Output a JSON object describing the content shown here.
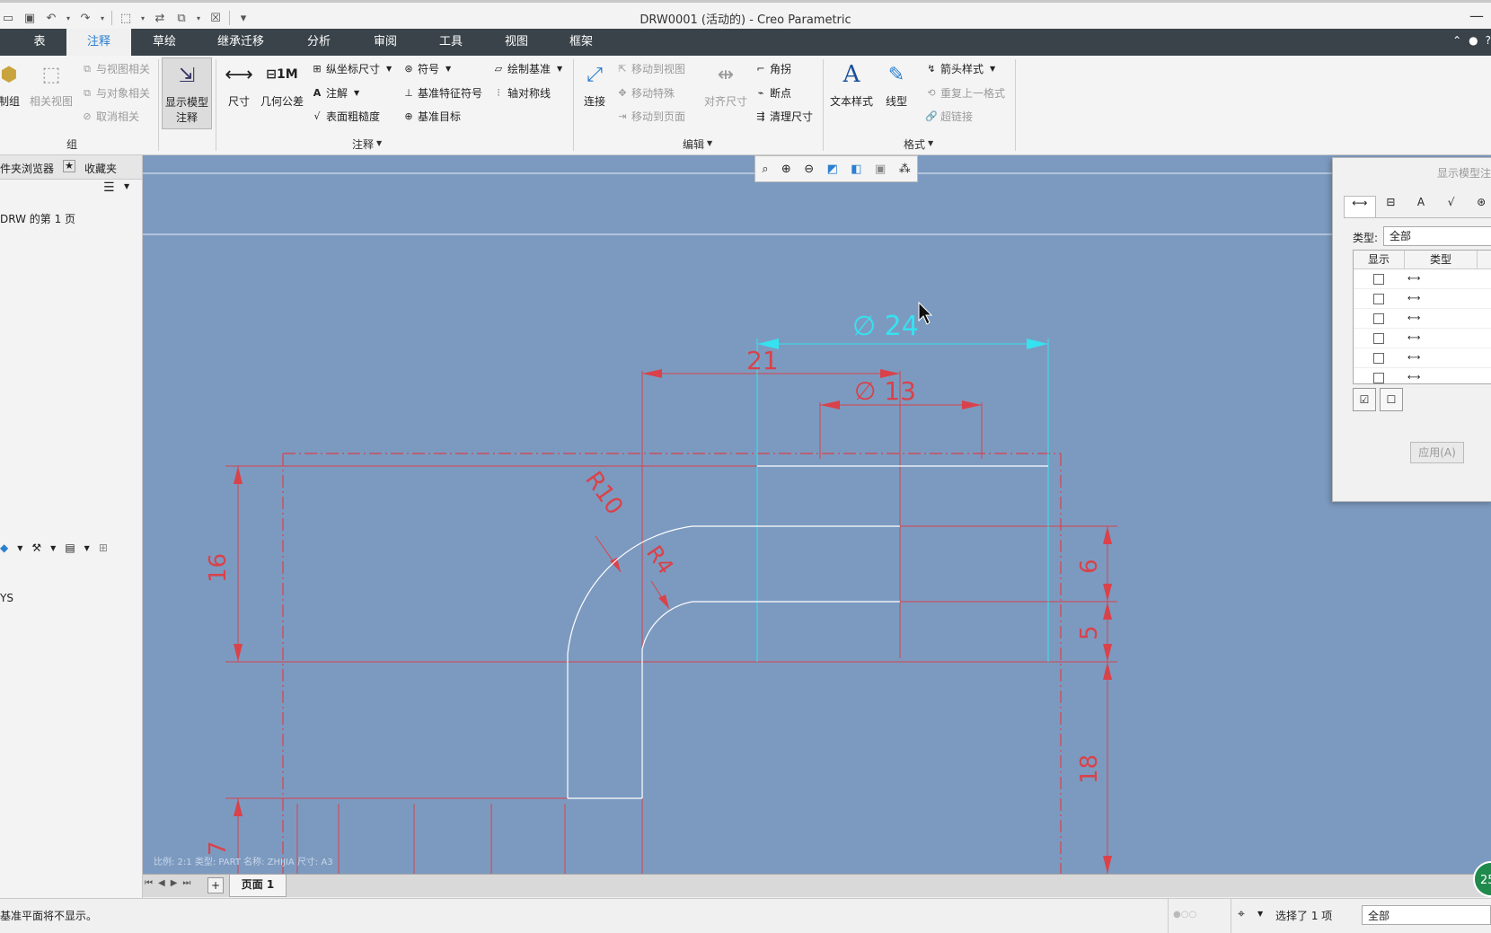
{
  "window": {
    "title": "DRW0001 (活动的) - Creo Parametric"
  },
  "tabs": [
    "表",
    "注释",
    "草绘",
    "继承迁移",
    "分析",
    "审阅",
    "工具",
    "视图",
    "框架"
  ],
  "ribbon": {
    "group_zu": {
      "make_group": "制组",
      "related_view": "相关视图",
      "view_related": "与视图相关",
      "object_related": "与对象相关",
      "cancel_related": "取消相关",
      "label": "组"
    },
    "show_model": {
      "label1": "显示模型",
      "label2": "注释"
    },
    "annotate": {
      "dimension": "尺寸",
      "gtol": "几何公差",
      "ordinate": "纵坐标尺寸",
      "note": "注解",
      "surface_finish": "表面粗糙度",
      "symbol": "符号",
      "datum_feature": "基准特征符号",
      "datum_target": "基准目标",
      "draw_datum": "绘制基准",
      "axis_symmetry": "轴对称线",
      "label": "注释"
    },
    "edit": {
      "connect": "连接",
      "move_to_view": "移动到视图",
      "move_special": "移动特殊",
      "move_to_page": "移动到页面",
      "align_dims": "对齐尺寸",
      "corner": "角拐",
      "breakpoint": "断点",
      "cleanup": "清理尺寸",
      "label": "编辑"
    },
    "format": {
      "text_style": "文本样式",
      "line_style": "线型",
      "arrow_style": "箭头样式",
      "repeat_format": "重复上一格式",
      "hyperlink": "超链接",
      "label": "格式"
    }
  },
  "left_panel": {
    "tab_browser": "件夹浏览器",
    "tab_favorites": "收藏夹",
    "tree_item": "DRW 的第 1 页",
    "tree_item2": "YS"
  },
  "canvas": {
    "dims": {
      "phi24": "∅ 24",
      "d21": "21",
      "phi13": "∅ 13",
      "r10": "R10",
      "r4": "R4",
      "d16": "16",
      "d6": "6",
      "d5": "5",
      "d18": "18",
      "d7": "7"
    },
    "footer_text": "比例: 2:1    类型: PART    名称: ZHIJIA   尺寸: A3"
  },
  "dialog": {
    "title": "显示模型注",
    "type_label": "类型:",
    "type_value": "全部",
    "col_show": "显示",
    "col_type": "类型",
    "rows": 6,
    "apply": "应用(A)"
  },
  "page_bar": {
    "page1": "页面 1"
  },
  "status": {
    "message": "基准平面将不显示。",
    "selected": "选择了 1 项",
    "filter": "全部",
    "badge": "25"
  },
  "colors": {
    "canvas_bg": "#7c9ac0",
    "dim_red": "#d9424a",
    "dim_cyan": "#35e2f0",
    "ribbon_dark": "#394349",
    "accent": "#2a7fd0"
  }
}
